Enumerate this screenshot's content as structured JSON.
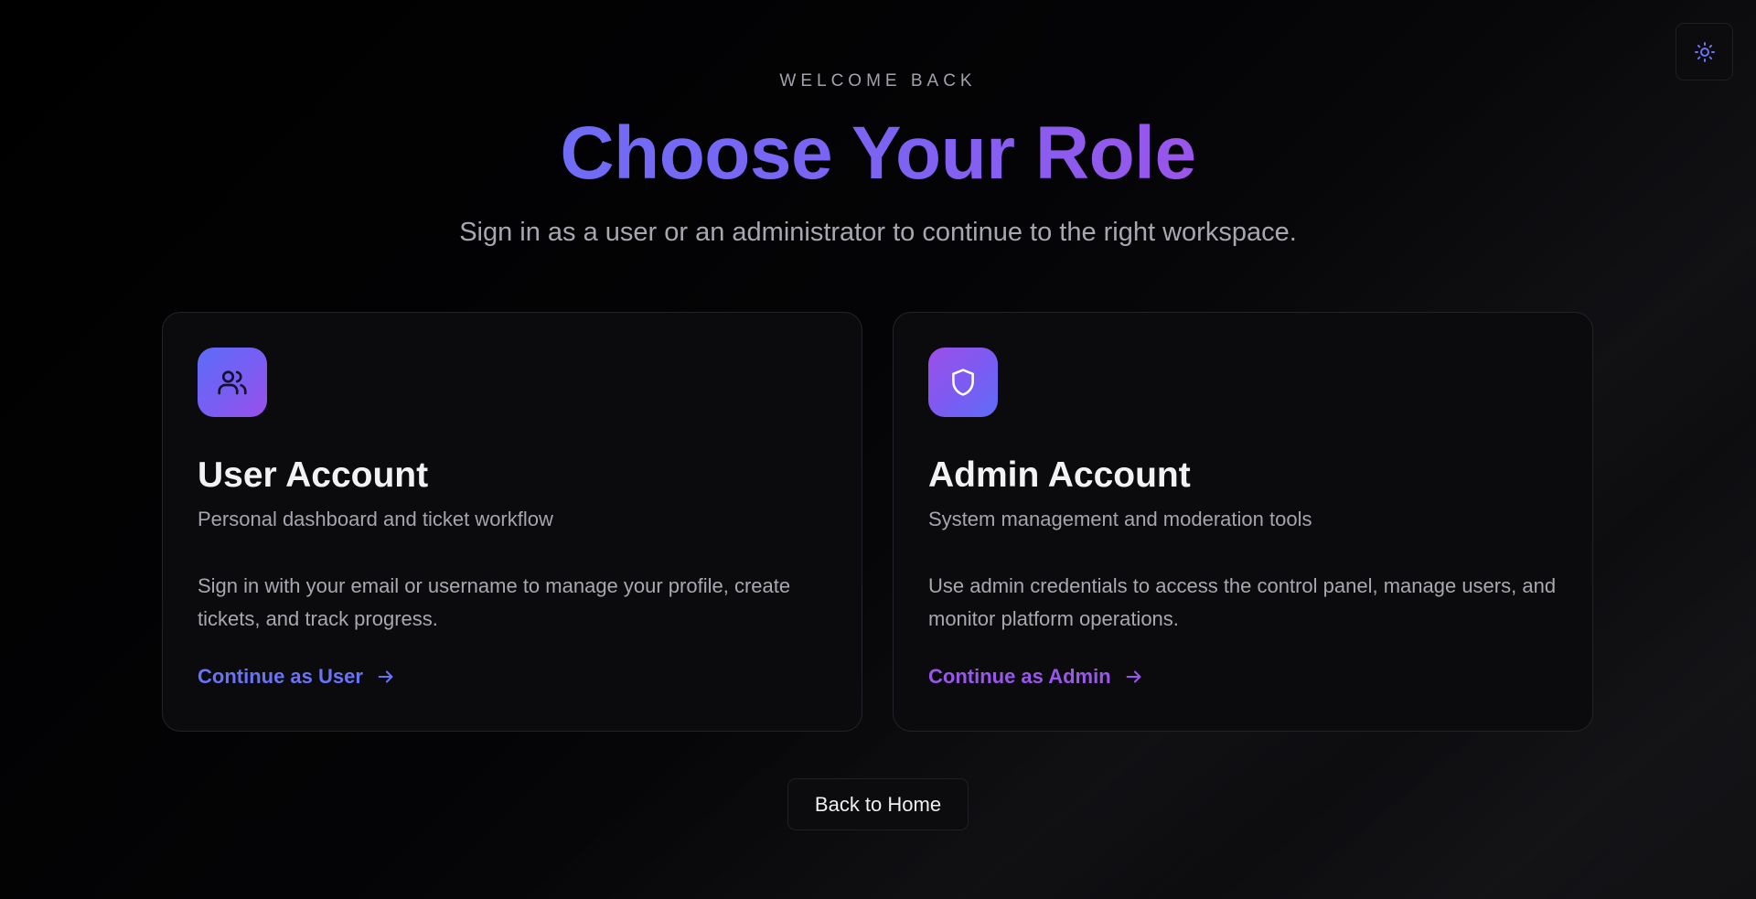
{
  "theme_toggle": {
    "icon": "sun-icon",
    "color": "#6a73f6"
  },
  "header": {
    "eyebrow": "WELCOME BACK",
    "title": "Choose Your Role",
    "subtitle": "Sign in as a user or an administrator to continue to the right workspace."
  },
  "cards": [
    {
      "icon": "users-icon",
      "title": "User Account",
      "tagline": "Personal dashboard and ticket workflow",
      "description": "Sign in with your email or username to manage your profile, create tickets, and track progress.",
      "cta": "Continue as User",
      "accent": "#6a73f6"
    },
    {
      "icon": "shield-icon",
      "title": "Admin Account",
      "tagline": "System management and moderation tools",
      "description": "Use admin credentials to access the control panel, manage users, and monitor platform operations.",
      "cta": "Continue as Admin",
      "accent": "#9a57ec"
    }
  ],
  "footer": {
    "back_label": "Back to Home"
  },
  "colors": {
    "background": "#000000",
    "card_background": "#0b0b0d",
    "gradient_start": "#6f6cf6",
    "gradient_end": "#9a55ea"
  }
}
